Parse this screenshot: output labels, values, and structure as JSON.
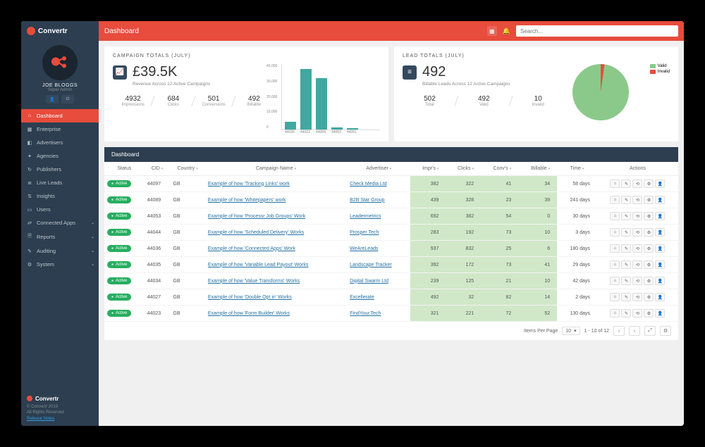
{
  "brand": "Convertr",
  "header": {
    "title": "Dashboard",
    "search_placeholder": "Search..."
  },
  "user": {
    "name": "JOE BLOGGS",
    "role": "Super Admin"
  },
  "nav": [
    {
      "icon": "⌂",
      "label": "Dashboard",
      "active": true
    },
    {
      "icon": "▦",
      "label": "Enterprise"
    },
    {
      "icon": "◧",
      "label": "Advertisers"
    },
    {
      "icon": "✦",
      "label": "Agencies"
    },
    {
      "icon": "↻",
      "label": "Publishers"
    },
    {
      "icon": "≣",
      "label": "Live Leads"
    },
    {
      "icon": "⇅",
      "label": "Insights"
    },
    {
      "icon": "▭",
      "label": "Users"
    },
    {
      "icon": "⇄",
      "label": "Connected Apps",
      "chev": true
    },
    {
      "icon": "🗎",
      "label": "Reports",
      "chev": true
    },
    {
      "icon": "✎",
      "label": "Auditing",
      "chev": true
    },
    {
      "icon": "⚙",
      "label": "System",
      "chev": true
    }
  ],
  "footer": {
    "copyright": "© Convertr 2019",
    "rights": "All Rights Reserved",
    "release_notes": "Release Notes"
  },
  "campaign_totals": {
    "title": "CAMPAIGN TOTALS (JULY)",
    "big": "£39.5K",
    "sub": "Revenue Across 12 Active Campaigns",
    "stats": [
      {
        "v": "4932",
        "l": "Impressions"
      },
      {
        "v": "684",
        "l": "Clicks"
      },
      {
        "v": "501",
        "l": "Conversions"
      },
      {
        "v": "492",
        "l": "Billable"
      }
    ]
  },
  "lead_totals": {
    "title": "LEAD TOTALS (JULY)",
    "big": "492",
    "sub": "Billable Leads Across 12 Active Campaigns",
    "stats": [
      {
        "v": "502",
        "l": "Total"
      },
      {
        "v": "492",
        "l": "Valid"
      },
      {
        "v": "10",
        "l": "Invalid"
      }
    ],
    "legend": [
      {
        "color": "#8bc98b",
        "label": "Valid"
      },
      {
        "color": "#e74c3c",
        "label": "Invalid"
      }
    ]
  },
  "chart_data": {
    "type": "bar",
    "title": "",
    "ylabel": "",
    "xlabel": "",
    "ylim": [
      0,
      40000
    ],
    "yticks": [
      0,
      10000,
      20000,
      30000,
      40000
    ],
    "categories": [
      "44035",
      "44023",
      "44004",
      "44053",
      "44001"
    ],
    "values": [
      5000,
      38000,
      32000,
      1500,
      1000
    ]
  },
  "pie_data": {
    "type": "pie",
    "series": [
      {
        "name": "Valid",
        "value": 492,
        "color": "#8bc98b"
      },
      {
        "name": "Invalid",
        "value": 10,
        "color": "#e74c3c"
      }
    ]
  },
  "table": {
    "title": "Dashboard",
    "columns": [
      "Status",
      "CID",
      "Country",
      "Campaign Name",
      "Advertiser",
      "Impr's",
      "Clicks",
      "Conv's",
      "Billable",
      "Time",
      "Actions"
    ],
    "rows": [
      {
        "status": "Active",
        "cid": "44097",
        "country": "GB",
        "name": "Example of how 'Tracking Links' work",
        "adv": "Check Media Ltd",
        "impr": 382,
        "clicks": 322,
        "convs": 41,
        "billable": 34,
        "time": "58 days"
      },
      {
        "status": "Active",
        "cid": "44089",
        "country": "GB",
        "name": "Example of how 'Whitepapers' work",
        "adv": "B2B Star Group",
        "impr": 439,
        "clicks": 328,
        "convs": 23,
        "billable": 39,
        "time": "241 days"
      },
      {
        "status": "Active",
        "cid": "44053",
        "country": "GB",
        "name": "Example of how 'Processr Job Groups' Work",
        "adv": "Leadermetrics",
        "impr": 692,
        "clicks": 382,
        "convs": 54,
        "billable": 0,
        "time": "30 days"
      },
      {
        "status": "Active",
        "cid": "44044",
        "country": "GB",
        "name": "Example of how 'Scheduled Delivery' Works",
        "adv": "Prosper Tech",
        "impr": 283,
        "clicks": 192,
        "convs": 73,
        "billable": 10,
        "time": "3 days"
      },
      {
        "status": "Active",
        "cid": "44036",
        "country": "GB",
        "name": "Example of how 'Connected Apps' Work",
        "adv": "WeAreLeads",
        "impr": 937,
        "clicks": 832,
        "convs": 25,
        "billable": 6,
        "time": "180 days"
      },
      {
        "status": "Active",
        "cid": "44035",
        "country": "GB",
        "name": "Example of how 'Variable Lead Payout' Works",
        "adv": "Landscape Tracker",
        "impr": 392,
        "clicks": 172,
        "convs": 73,
        "billable": 41,
        "time": "29 days"
      },
      {
        "status": "Active",
        "cid": "44034",
        "country": "GB",
        "name": "Example of how 'Value Transforms' Works",
        "adv": "Digital Swarm Ltd",
        "impr": 239,
        "clicks": 125,
        "convs": 21,
        "billable": 10,
        "time": "42 days"
      },
      {
        "status": "Active",
        "cid": "44027",
        "country": "GB",
        "name": "Example of how 'Double Opt in' Works",
        "adv": "Excellerate",
        "impr": 492,
        "clicks": 32,
        "convs": 82,
        "billable": 14,
        "time": "2 days"
      },
      {
        "status": "Active",
        "cid": "44023",
        "country": "GB",
        "name": "Example of how 'Form Builder' Works",
        "adv": "FindYour.Tech",
        "impr": 321,
        "clicks": 221,
        "convs": 72,
        "billable": 52,
        "time": "130 days"
      }
    ],
    "items_per_page_label": "Items Per Page",
    "items_per_page": "10",
    "range": "1 - 10 of 12"
  }
}
